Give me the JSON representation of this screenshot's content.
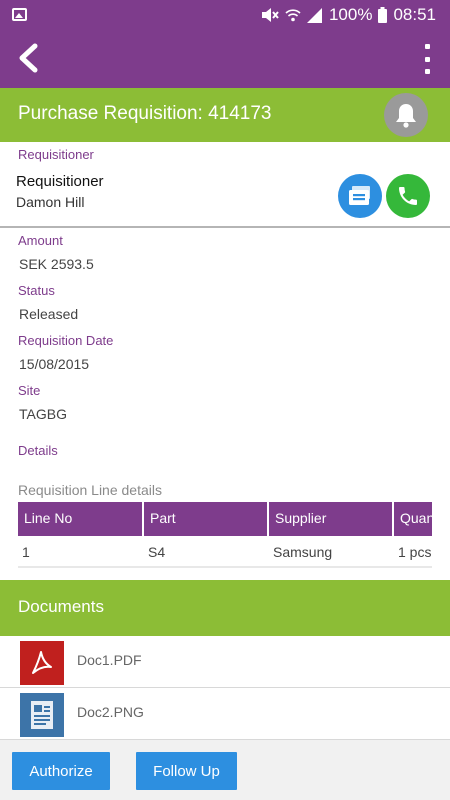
{
  "status_bar": {
    "battery": "100%",
    "time": "08:51",
    "icons": [
      "gallery-icon",
      "mute-icon",
      "wifi-icon",
      "signal-icon",
      "battery-icon"
    ]
  },
  "app_bar": {
    "back_icon": "chevron-left-icon",
    "menu_icon": "more-vertical-icon",
    "background": "#7e3c8c"
  },
  "header": {
    "title": "Purchase Requisition: 414173",
    "bell_icon": "bell-icon",
    "background": "#8cbd36"
  },
  "requisitioner": {
    "section_label": "Requisitioner",
    "title": "Requisitioner",
    "name": "Damon Hill",
    "mail_icon": "mail-icon",
    "phone_icon": "phone-icon"
  },
  "fields": {
    "amount_label": "Amount",
    "amount_value": "SEK 2593.5",
    "status_label": "Status",
    "status_value": "Released",
    "date_label": "Requisition Date",
    "date_value": "15/08/2015",
    "site_label": "Site",
    "site_value": "TAGBG",
    "details_label": "Details"
  },
  "line_details": {
    "title": "Requisition Line details",
    "columns": [
      "Line No",
      "Part",
      "Supplier",
      "Quantity"
    ],
    "rows": [
      [
        "1",
        "S4",
        "Samsung",
        "1 pcs"
      ]
    ]
  },
  "documents": {
    "title": "Documents",
    "items": [
      {
        "name": "Doc1.PDF",
        "icon": "pdf-file-icon"
      },
      {
        "name": "Doc2.PNG",
        "icon": "image-file-icon"
      }
    ]
  },
  "actions": {
    "authorize": "Authorize",
    "follow_up": "Follow Up",
    "button_color": "#2d8fe0"
  }
}
